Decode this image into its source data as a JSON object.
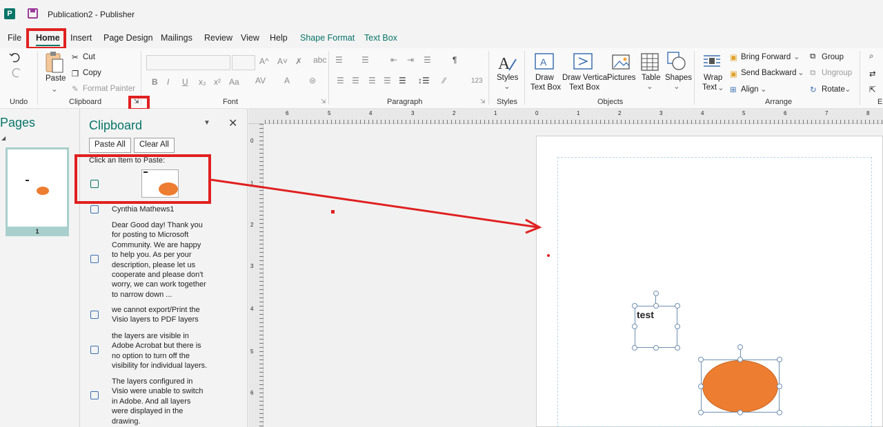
{
  "window": {
    "title": "Publication2  -  Publisher"
  },
  "menu": {
    "tabs": [
      "File",
      "Home",
      "Insert",
      "Page Design",
      "Mailings",
      "Review",
      "View",
      "Help",
      "Shape Format",
      "Text Box"
    ],
    "active": "Home"
  },
  "ribbon": {
    "undo_group": "Undo",
    "clipboard": {
      "paste": "Paste",
      "cut": "Cut",
      "copy": "Copy",
      "format_painter": "Format Painter",
      "label": "Clipboard"
    },
    "font": {
      "label": "Font",
      "bold": "B",
      "italic": "I",
      "underline": "U",
      "sub": "x₂",
      "sup": "x²",
      "case": "Aa"
    },
    "paragraph": {
      "label": "Paragraph",
      "pilcrow": "¶",
      "numbers": "123"
    },
    "styles": {
      "button": "Styles",
      "label": "Styles"
    },
    "objects": {
      "label": "Objects",
      "draw_text_box_l1": "Draw",
      "draw_text_box_l2": "Text Box",
      "draw_vertical_l1": "Draw Vertical",
      "draw_vertical_l2": "Text Box",
      "pictures": "Pictures",
      "table": "Table",
      "shapes": "Shapes"
    },
    "arrange": {
      "label": "Arrange",
      "wrap_l1": "Wrap",
      "wrap_l2": "Text",
      "bring_forward": "Bring Forward",
      "send_backward": "Send Backward",
      "align": "Align",
      "group": "Group",
      "ungroup": "Ungroup",
      "rotate": "Rotate"
    },
    "edge_label": "E"
  },
  "pages_pane": {
    "title": "Pages",
    "page_number": "1"
  },
  "clipboard_pane": {
    "title": "Clipboard",
    "paste_all": "Paste All",
    "clear_all": "Clear All",
    "hint": "Click an Item to Paste:",
    "items": [
      "Cynthia Mathews1",
      "Dear Good day! Thank you for posting to Microsoft Community. We are happy to help you. As per your description, please let us cooperate and please don't worry, we can work together to narrow down ...",
      "we cannot export/Print the Visio layers to PDF layers",
      "the layers are visible in Adobe Acrobat but there is no option to turn off the visibility for individual layers.",
      "The layers configured in Visio were unable to switch in Adobe. And all layers were displayed in the drawing."
    ]
  },
  "canvas": {
    "textbox_text": "test",
    "shape_color": "#ed7d31",
    "annotation_color": "#e02020"
  },
  "ruler": {
    "top": [
      "6",
      "5",
      "4",
      "3",
      "2",
      "1",
      "0",
      "1",
      "2",
      "3",
      "4",
      "5",
      "6",
      "7",
      "8"
    ],
    "left": [
      "0",
      "1",
      "2",
      "3",
      "4",
      "5",
      "6"
    ]
  }
}
